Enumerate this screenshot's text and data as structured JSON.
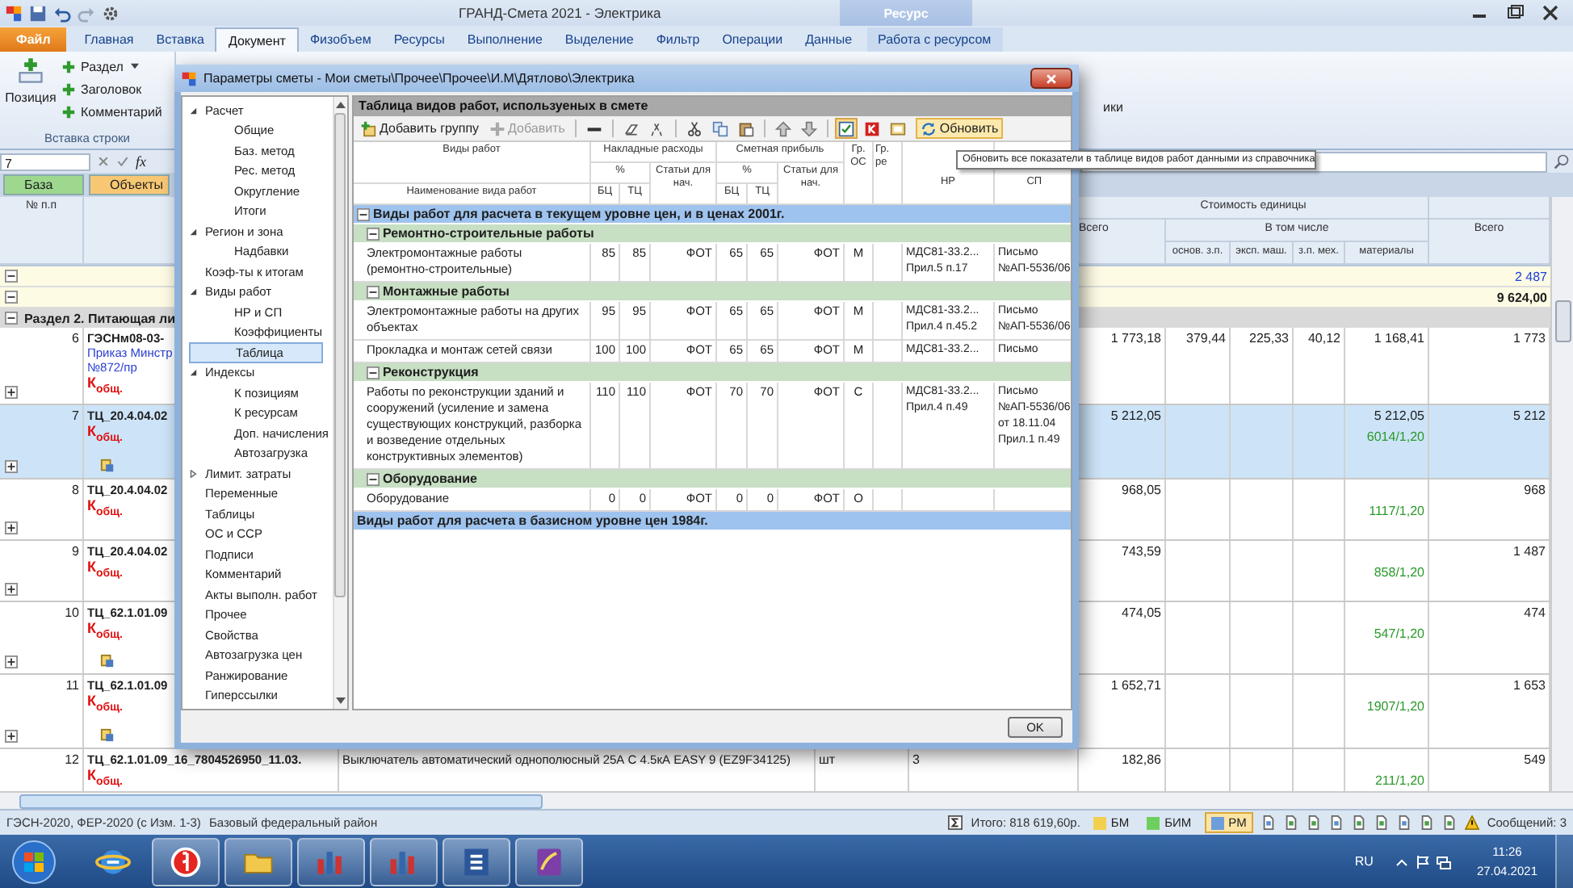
{
  "window": {
    "title": "ГРАНД-Смета 2021 - Электрика",
    "context_tab": "Ресурс"
  },
  "ribbon_tabs": [
    {
      "label": "Файл",
      "kind": "file",
      "selected": false
    },
    {
      "label": "Главная",
      "kind": "tab",
      "selected": false
    },
    {
      "label": "Вставка",
      "kind": "tab",
      "selected": false
    },
    {
      "label": "Документ",
      "kind": "tab",
      "selected": true
    },
    {
      "label": "Физобъем",
      "kind": "tab",
      "selected": false
    },
    {
      "label": "Ресурсы",
      "kind": "tab",
      "selected": false
    },
    {
      "label": "Выполнение",
      "kind": "tab",
      "selected": false
    },
    {
      "label": "Выделение",
      "kind": "tab",
      "selected": false
    },
    {
      "label": "Фильтр",
      "kind": "tab",
      "selected": false
    },
    {
      "label": "Операции",
      "kind": "tab",
      "selected": false
    },
    {
      "label": "Данные",
      "kind": "tab",
      "selected": false
    },
    {
      "label": "Работа с ресурсом",
      "kind": "context",
      "selected": false
    }
  ],
  "ribbon": {
    "large_button": "Позиция",
    "small_buttons": [
      "Раздел",
      "Заголовок",
      "Комментарий"
    ],
    "group_label": "Вставка строки",
    "fragment": "ики"
  },
  "formula_bar": {
    "cell": "7",
    "function_label": "fx"
  },
  "filters": [
    {
      "label": "База",
      "color": "#9ed88f"
    },
    {
      "label": "Объекты",
      "color": "#f8c774"
    }
  ],
  "table": {
    "number_header": "№ п.п",
    "unit_cost_header": "Стоимость единицы",
    "total_header": "Всего",
    "including_header": "В том числе",
    "sub_headers": [
      "основ. з.п.",
      "эксп. маш.",
      "з.п. мех.",
      "материалы"
    ],
    "total2_header": "Всего",
    "totals": [
      {
        "value": "2 487",
        "kind": "link"
      },
      {
        "value": "9 624,00",
        "kind": "bold"
      }
    ],
    "section": "Раздел 2. Питающая ли",
    "rows": [
      {
        "number": "6",
        "code": "ГЭСНм08-03-",
        "notes": [
          "Приказ Минстр",
          "№872/пр"
        ],
        "coef": "К$_{общ.}$",
        "linked": false,
        "selected": false,
        "total": "1 773,18",
        "base_wage": "379,44",
        "machine": "225,33",
        "mech_wage": "40,12",
        "materials": "1 168,41",
        "total2": "1 773"
      },
      {
        "number": "7",
        "code": "ТЦ_20.4.04.02",
        "coef": "К$_{общ.}$",
        "linked": true,
        "selected": true,
        "total": "5 212,05",
        "materials": "5 212,05",
        "materials_index": "6014/1,20",
        "total2": "5 212"
      },
      {
        "number": "8",
        "code": "ТЦ_20.4.04.02",
        "coef": "К$_{общ.}$",
        "linked": false,
        "selected": false,
        "total": "968,05",
        "materials_index": "1117/1,20",
        "total2": "968"
      },
      {
        "number": "9",
        "code": "ТЦ_20.4.04.02",
        "coef": "К$_{общ.}$",
        "linked": false,
        "selected": false,
        "total": "743,59",
        "materials_index": "858/1,20",
        "total2": "1 487"
      },
      {
        "number": "10",
        "code": "ТЦ_62.1.01.09",
        "coef": "К$_{общ.}$",
        "linked": true,
        "selected": false,
        "total": "474,05",
        "materials_index": "547/1,20",
        "total2": "474"
      },
      {
        "number": "11",
        "code": "ТЦ_62.1.01.09",
        "coef": "К$_{общ.}$",
        "linked": true,
        "selected": false,
        "total": "1 652,71",
        "materials_index": "1907/1,20",
        "total2": "1 653"
      },
      {
        "number": "12",
        "code": "ТЦ_62.1.01.09_16_7804526950_11.03.",
        "name": "Выключатель автоматический однополюсный 25А С 4.5кА EASY 9 (EZ9F34125)",
        "unit": "шт",
        "qty": "3",
        "coef": "К$_{общ.}$",
        "linked": false,
        "selected": false,
        "total": "182,86",
        "materials_index": "211/1,20",
        "total2": "549"
      }
    ]
  },
  "dialog": {
    "title": "Параметры сметы - Мои сметы\\Прочее\\Прочее\\И.М\\Дятлово\\Электрика",
    "tree": [
      {
        "label": "Расчет",
        "expanded": true,
        "selected": false,
        "children": [
          {
            "label": "Общие",
            "selected": false
          },
          {
            "label": "Баз. метод",
            "selected": false
          },
          {
            "label": "Рес. метод",
            "selected": false
          },
          {
            "label": "Округление",
            "selected": false
          },
          {
            "label": "Итоги",
            "selected": false
          }
        ]
      },
      {
        "label": "Регион и зона",
        "expanded": true,
        "selected": false,
        "children": [
          {
            "label": "Надбавки",
            "selected": false
          }
        ]
      },
      {
        "label": "Коэф-ты к итогам",
        "selected": false
      },
      {
        "label": "Виды работ",
        "expanded": true,
        "selected": false,
        "children": [
          {
            "label": "НР и СП",
            "selected": false
          },
          {
            "label": "Коэффициенты",
            "selected": false
          },
          {
            "label": "Таблица",
            "selected": true
          }
        ]
      },
      {
        "label": "Индексы",
        "expanded": true,
        "selected": false,
        "children": [
          {
            "label": "К позициям",
            "selected": false
          },
          {
            "label": "К ресурсам",
            "selected": false
          },
          {
            "label": "Доп. начисления",
            "selected": false
          },
          {
            "label": "Автозагрузка",
            "selected": false
          }
        ]
      },
      {
        "label": "Лимит. затраты",
        "expanded": false,
        "selected": false
      },
      {
        "label": "Переменные",
        "selected": false
      },
      {
        "label": "Таблицы",
        "selected": false
      },
      {
        "label": "ОС и ССР",
        "selected": false
      },
      {
        "label": "Подписи",
        "selected": false
      },
      {
        "label": "Комментарий",
        "selected": false
      },
      {
        "label": "Акты выполн. работ",
        "selected": false
      },
      {
        "label": "Прочее",
        "selected": false
      },
      {
        "label": "Свойства",
        "selected": false
      },
      {
        "label": "Автозагрузка цен",
        "selected": false
      },
      {
        "label": "Ранжирование",
        "selected": false
      },
      {
        "label": "Гиперссылки",
        "selected": false
      }
    ],
    "panel_title": "Таблица видов работ, используеных в смете",
    "add_group": "Добавить группу",
    "add": {
      "label": "Добавить",
      "disabled": true
    },
    "tool_buttons": [
      {
        "pressed": false
      },
      {
        "pressed": false
      },
      {
        "pressed": false
      },
      {
        "pressed": false
      },
      {
        "pressed": false
      },
      {
        "pressed": false
      },
      {
        "pressed": false
      },
      {
        "pressed": false
      },
      {
        "pressed": true
      },
      {
        "pressed": false
      },
      {
        "pressed": false
      }
    ],
    "refresh": {
      "label": "Обновить",
      "highlighted": true
    },
    "tooltip": "Обновить все показатели в таблице видов работ данными из справочника",
    "header": {
      "work_types": "Виды работ",
      "work_name": "Наименование вида работ",
      "overhead": {
        "title": "Накладные расходы",
        "percent": "%",
        "base": "БЦ",
        "current": "ТЦ",
        "basis": "Статьи для нач."
      },
      "profit": {
        "title": "Сметная прибыль",
        "percent": "%",
        "base": "БЦ",
        "current": "ТЦ",
        "basis": "Статьи для нач."
      },
      "os_group": "Гр. ОС",
      "re_group": "Гр. ре",
      "just_overhead": "НР",
      "just_profit": "СП"
    },
    "groups": [
      {
        "title": "Виды работ для расчета в текущем уровне цен, и в ценах 2001г.",
        "expanded": true,
        "children": [
          {
            "title": "Ремонтно-строительные работы",
            "expanded": true,
            "rows": [
              {
                "name": "Электромонтажные работы (ремонтно-строительные)",
                "oh_base": "85",
                "oh_cur": "85",
                "oh_basis": "ФОТ",
                "pr_base": "65",
                "pr_cur": "65",
                "pr_basis": "ФОТ",
                "os": "М",
                "just_oh": [
                  "МДС81-33.2...",
                  "Прил.5 п.17"
                ],
                "just_pr": [
                  "Письмо",
                  "№АП-5536/06"
                ]
              }
            ]
          },
          {
            "title": "Монтажные работы",
            "expanded": true,
            "rows": [
              {
                "name": "Электромонтажные работы на других объектах",
                "oh_base": "95",
                "oh_cur": "95",
                "oh_basis": "ФОТ",
                "pr_base": "65",
                "pr_cur": "65",
                "pr_basis": "ФОТ",
                "os": "М",
                "just_oh": [
                  "МДС81-33.2...",
                  "Прил.4 п.45.2"
                ],
                "just_pr": [
                  "Письмо",
                  "№АП-5536/06"
                ]
              },
              {
                "name": "Прокладка и монтаж сетей связи",
                "oh_base": "100",
                "oh_cur": "100",
                "oh_basis": "ФОТ",
                "pr_base": "65",
                "pr_cur": "65",
                "pr_basis": "ФОТ",
                "os": "М",
                "just_oh": [
                  "МДС81-33.2..."
                ],
                "just_pr": [
                  "Письмо"
                ]
              }
            ]
          },
          {
            "title": "Реконструкция",
            "expanded": true,
            "rows": [
              {
                "name": "Работы по реконструкции зданий и сооружений (усиление и замена существующих конструкций, разборка и возведение отдельных конструктивных элементов)",
                "oh_base": "110",
                "oh_cur": "110",
                "oh_basis": "ФОТ",
                "pr_base": "70",
                "pr_cur": "70",
                "pr_basis": "ФОТ",
                "os": "С",
                "just_oh": [
                  "МДС81-33.2...",
                  "Прил.4 п.49"
                ],
                "just_pr": [
                  "Письмо",
                  "№АП-5536/06",
                  "от 18.11.04",
                  "Прил.1 п.49"
                ]
              }
            ]
          },
          {
            "title": "Оборудование",
            "expanded": true,
            "rows": [
              {
                "name": "Оборудование",
                "oh_base": "0",
                "oh_cur": "0",
                "oh_basis": "ФОТ",
                "pr_base": "0",
                "pr_cur": "0",
                "pr_basis": "ФОТ",
                "os": "О"
              }
            ]
          }
        ]
      },
      {
        "title": "Виды работ для расчета в базисном уровне цен 1984г."
      }
    ],
    "ok": "OK"
  },
  "status_bar": {
    "base": "ГЭСН-2020, ФЕР-2020 (с Изм. 1-3)",
    "region": "Базовый федеральный район",
    "total": "Итого: 818 619,60р.",
    "modes": [
      {
        "label": "БМ",
        "color": "#f3cf4e",
        "selected": false
      },
      {
        "label": "БИМ",
        "color": "#6fcf5e",
        "selected": false
      },
      {
        "label": "РМ",
        "color": "#6d9ddb",
        "selected": true
      }
    ],
    "messages": "Сообщений: 3"
  },
  "taskbar": {
    "apps": [
      {
        "running": false
      },
      {
        "running": true
      },
      {
        "running": true
      },
      {
        "running": true
      },
      {
        "running": true
      },
      {
        "running": true
      },
      {
        "running": true
      }
    ],
    "language": "RU",
    "time": "11:26",
    "date": "27.04.2021"
  }
}
